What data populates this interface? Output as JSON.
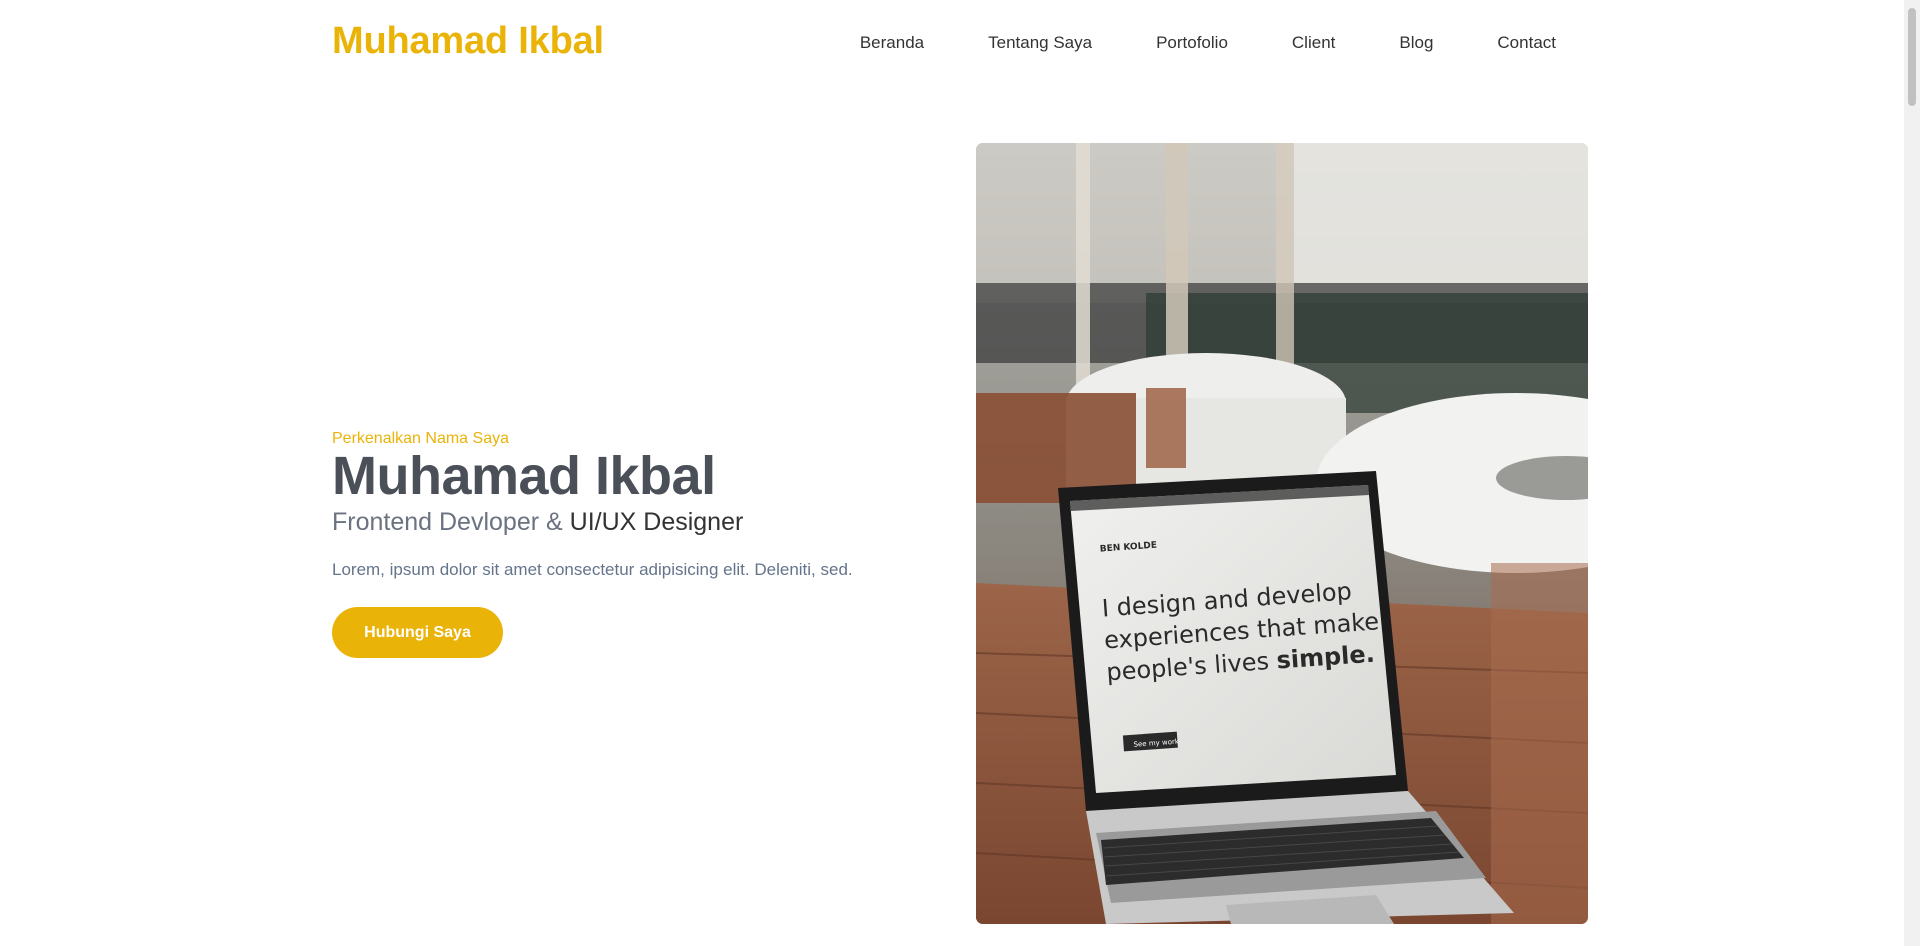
{
  "brand": {
    "name": "Muhamad Ikbal",
    "color": "#EAB308"
  },
  "nav": {
    "items": [
      {
        "label": "Beranda"
      },
      {
        "label": "Tentang Saya"
      },
      {
        "label": "Portofolio"
      },
      {
        "label": "Client"
      },
      {
        "label": "Blog"
      },
      {
        "label": "Contact"
      }
    ]
  },
  "hero": {
    "eyebrow": "Perkenalkan Nama Saya",
    "name": "Muhamad Ikbal",
    "role_prefix": "Frontend Devloper &",
    "role_strong": "UI/UX Designer",
    "description": "Lorem, ipsum dolor sit amet consectetur adipisicing elit. Deleniti, sed.",
    "cta_label": "Hubungi Saya",
    "image": {
      "kind": "photo",
      "subject": "laptop on wooden cafe table",
      "screen_text_lines": [
        "I design and develop",
        "experiences that make",
        "people's lives"
      ],
      "screen_text_emphasis": "simple.",
      "screen_brand": "BEN KOLDE",
      "screen_button": "See my work"
    }
  },
  "colors": {
    "accent": "#EAB308",
    "heading": "#4b4f58",
    "text": "#333333",
    "muted": "#64748b"
  }
}
